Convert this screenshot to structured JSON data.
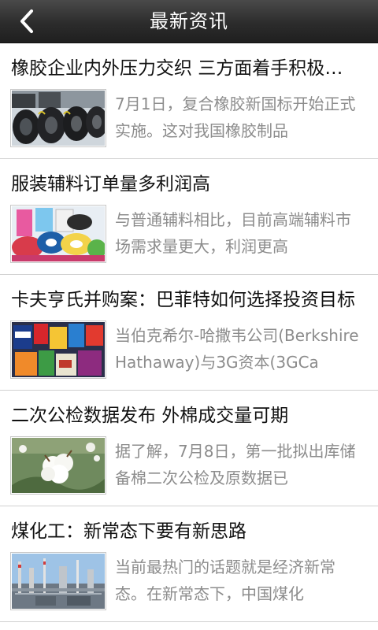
{
  "header": {
    "title": "最新资讯",
    "back_icon": "chevron-left-icon"
  },
  "articles": [
    {
      "title": "橡胶企业内外压力交织 三方面着手积极应对",
      "summary": "7月1日，复合橡胶新国标开始正式实施。这对我国橡胶制品",
      "thumbnail": "tires-image"
    },
    {
      "title": "服装辅料订单量多利润高",
      "summary": "与普通辅料相比，目前高端辅料市场需求量更大，利润更高",
      "thumbnail": "ribbon-rolls-image"
    },
    {
      "title": "卡夫亨氏并购案：巴菲特如何选择投资目标",
      "summary": "当伯克希尔-哈撒韦公司(BerkshireHathaway)与3G资本(3GCa",
      "thumbnail": "food-products-image"
    },
    {
      "title": "二次公检数据发布 外棉成交量可期",
      "summary": "据了解，7月8日，第一批拟出库储备棉二次公检及原数据已",
      "thumbnail": "cotton-boll-image"
    },
    {
      "title": "煤化工：新常态下要有新思路",
      "summary": "当前最热门的话题就是经济新常态。在新常态下，中国煤化",
      "thumbnail": "chemical-plant-image"
    }
  ]
}
